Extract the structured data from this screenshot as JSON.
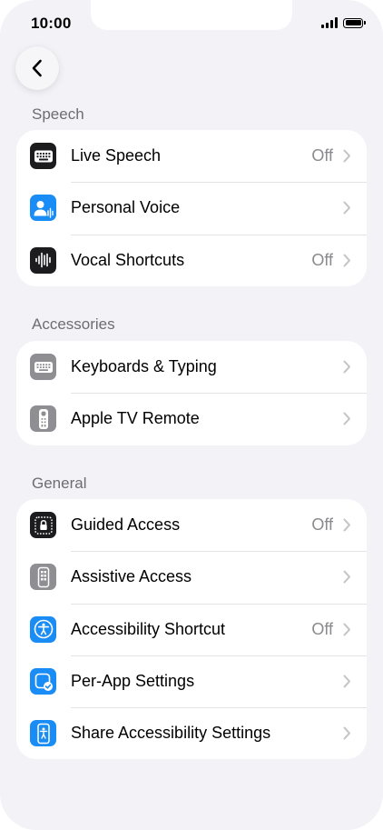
{
  "status_bar": {
    "time": "10:00"
  },
  "sections": {
    "speech": {
      "header": "Speech",
      "rows": [
        {
          "label": "Live Speech",
          "value": "Off"
        },
        {
          "label": "Personal Voice",
          "value": ""
        },
        {
          "label": "Vocal Shortcuts",
          "value": "Off"
        }
      ]
    },
    "accessories": {
      "header": "Accessories",
      "rows": [
        {
          "label": "Keyboards & Typing",
          "value": ""
        },
        {
          "label": "Apple TV Remote",
          "value": ""
        }
      ]
    },
    "general": {
      "header": "General",
      "rows": [
        {
          "label": "Guided Access",
          "value": "Off"
        },
        {
          "label": "Assistive Access",
          "value": ""
        },
        {
          "label": "Accessibility Shortcut",
          "value": "Off"
        },
        {
          "label": "Per-App Settings",
          "value": ""
        },
        {
          "label": "Share Accessibility Settings",
          "value": ""
        }
      ]
    }
  },
  "icons": {
    "live_speech": "keyboard-icon",
    "personal_voice": "person-waveform-icon",
    "vocal_shortcuts": "waveform-icon",
    "keyboards": "keyboard-icon",
    "apple_tv_remote": "remote-icon",
    "guided_access": "lock-icon",
    "assistive_access": "phone-grid-icon",
    "accessibility_shortcut": "accessibility-icon",
    "per_app_settings": "app-checkmark-icon",
    "share_accessibility": "share-accessibility-icon",
    "back": "chevron-left-icon",
    "row_chevron": "chevron-right-icon"
  },
  "colors": {
    "background": "#f2f2f7",
    "card": "#ffffff",
    "secondary_text": "#8a8a8e",
    "blue_icon": "#1a8cf5",
    "gray_icon": "#8e8e93",
    "black_icon": "#1c1c1e"
  }
}
